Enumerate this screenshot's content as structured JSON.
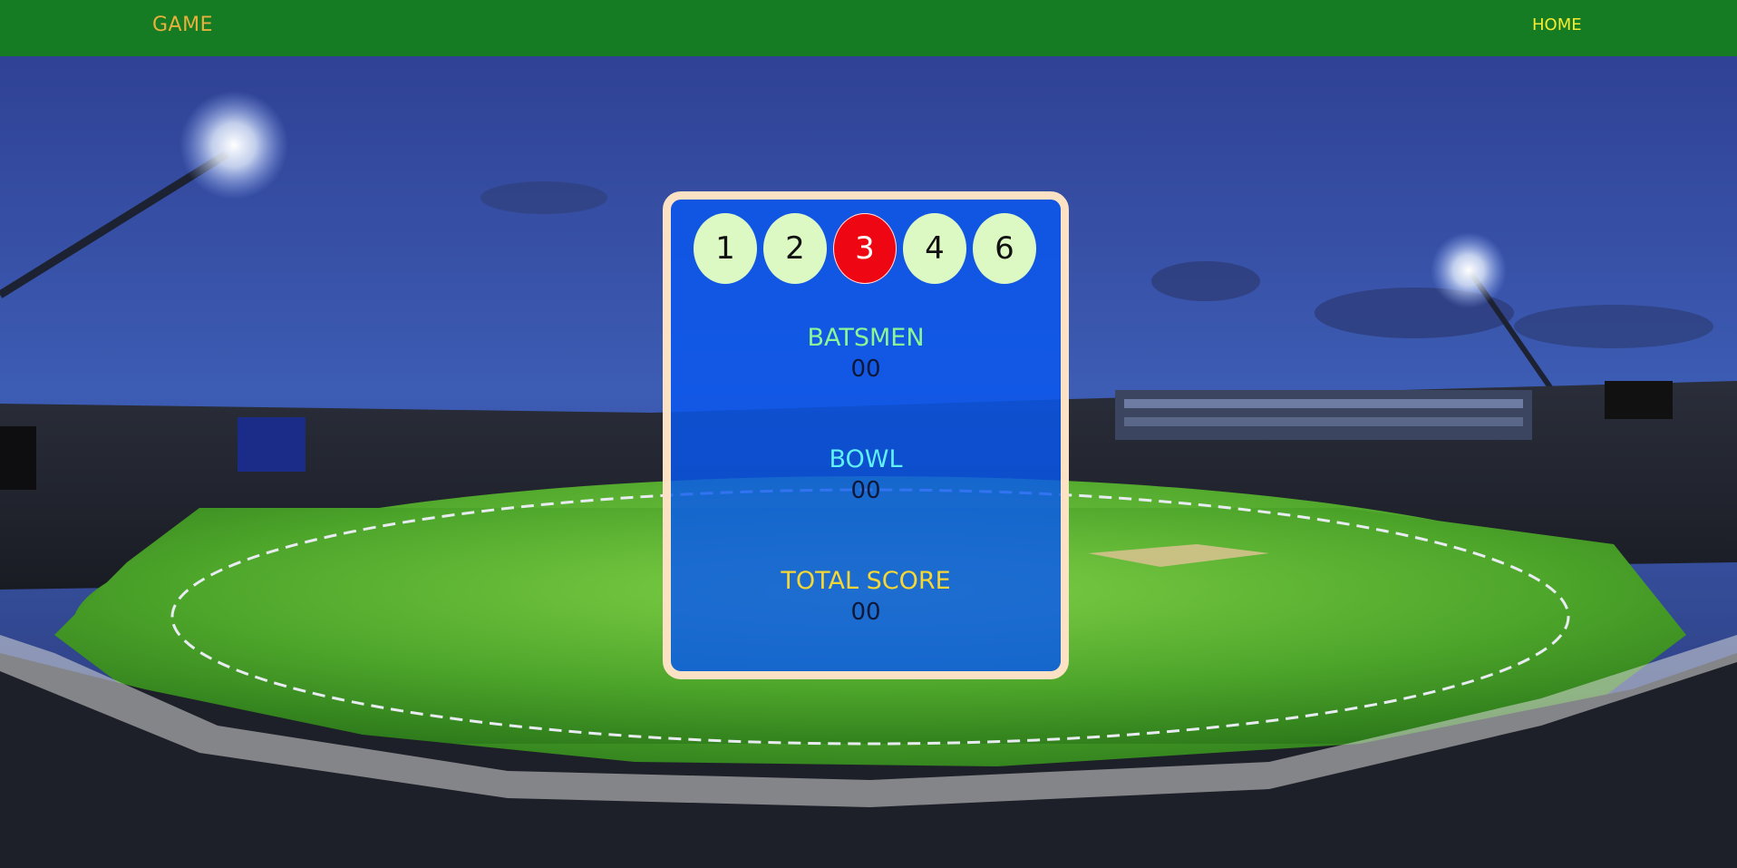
{
  "navbar": {
    "brand": "GAME",
    "home_label": "HOME"
  },
  "game": {
    "run_options": [
      {
        "label": "1",
        "selected": false
      },
      {
        "label": "2",
        "selected": false
      },
      {
        "label": "3",
        "selected": true
      },
      {
        "label": "4",
        "selected": false
      },
      {
        "label": "6",
        "selected": false
      }
    ],
    "batsmen": {
      "label": "BATSMEN",
      "value": "00"
    },
    "bowl": {
      "label": "BOWL",
      "value": "00"
    },
    "total_score": {
      "label": "TOTAL SCORE",
      "value": "00"
    }
  },
  "colors": {
    "navbar": "#167c23",
    "brand": "#e8b03c",
    "home": "#f3ec33",
    "panel": "#0858f0",
    "panel_border": "#fbe2c4",
    "ball": "#ddf9c3",
    "ball_selected": "#ee0712"
  }
}
